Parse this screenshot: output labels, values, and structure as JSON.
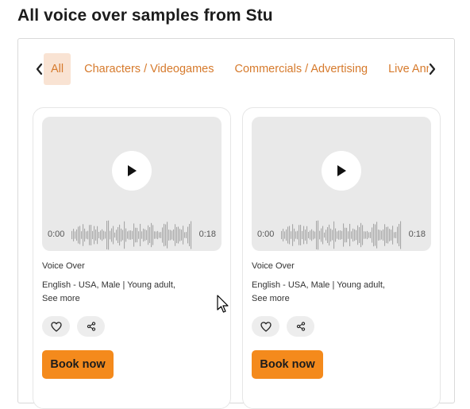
{
  "page": {
    "title": "All voice over samples from Stu"
  },
  "tabs": {
    "items": [
      {
        "label": "All",
        "active": true
      },
      {
        "label": "Characters / Videogames",
        "active": false
      },
      {
        "label": "Commercials / Advertising",
        "active": false
      },
      {
        "label": "Live Announcer",
        "active": false
      }
    ],
    "prev_icon": "chevron-left-icon",
    "next_icon": "chevron-right-icon"
  },
  "cards": [
    {
      "start_time": "0:00",
      "end_time": "0:18",
      "title": "Voice Over",
      "description": "English - USA, Male | Young adult,",
      "see_more": "See more",
      "book_label": "Book now"
    },
    {
      "start_time": "0:00",
      "end_time": "0:18",
      "title": "Voice Over",
      "description": "English - USA, Male | Young adult,",
      "see_more": "See more",
      "book_label": "Book now"
    }
  ],
  "colors": {
    "accent": "#d67a2c",
    "active_tab_bg": "#f9e3d3",
    "book_button": "#f48a1c",
    "player_bg": "#e9e9e9"
  }
}
